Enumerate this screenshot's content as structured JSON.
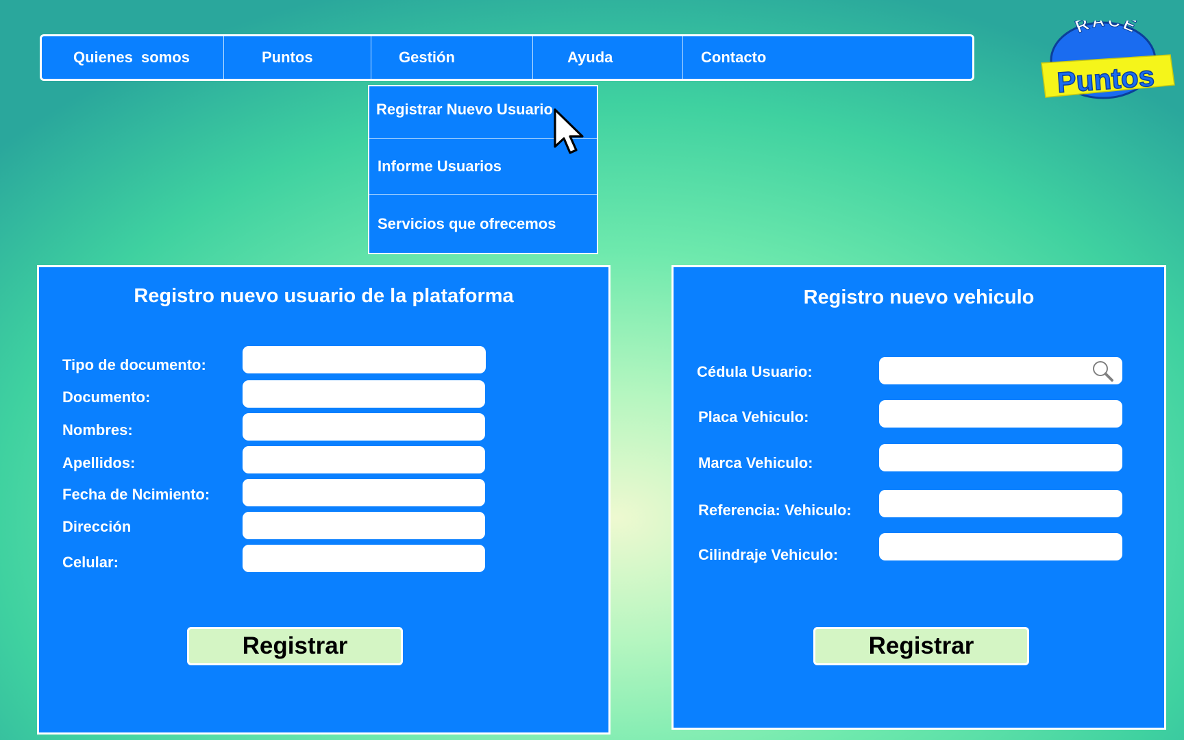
{
  "nav": {
    "items": [
      {
        "label": "Quienes  somos"
      },
      {
        "label": "Puntos"
      },
      {
        "label": "Gestión"
      },
      {
        "label": "Ayuda"
      },
      {
        "label": "Contacto"
      }
    ]
  },
  "dropdown": {
    "items": [
      {
        "label": "Registrar Nuevo Usuario"
      },
      {
        "label": "Informe Usuarios"
      },
      {
        "label": "Servicios que ofrecemos"
      }
    ]
  },
  "logo": {
    "top_text": "RACE",
    "bottom_text": "Puntos"
  },
  "user_form": {
    "title": "Registro nuevo usuario de la plataforma",
    "fields": [
      {
        "label": "Tipo de documento:",
        "value": ""
      },
      {
        "label": "Documento:",
        "value": ""
      },
      {
        "label": "Nombres:",
        "value": ""
      },
      {
        "label": "Apellidos:",
        "value": ""
      },
      {
        "label": "Fecha de Ncimiento:",
        "value": ""
      },
      {
        "label": "Dirección",
        "value": ""
      },
      {
        "label": "Celular:",
        "value": ""
      }
    ],
    "submit_label": "Registrar"
  },
  "vehicle_form": {
    "title": "Registro nuevo vehiculo",
    "fields": [
      {
        "label": "Cédula Usuario:",
        "value": "",
        "icon": "search-icon"
      },
      {
        "label": "Placa Vehiculo:",
        "value": ""
      },
      {
        "label": "Marca Vehiculo:",
        "value": ""
      },
      {
        "label": "Referencia: Vehiculo:",
        "value": ""
      },
      {
        "label": "Cilindraje Vehiculo:",
        "value": ""
      }
    ],
    "submit_label": "Registrar"
  },
  "colors": {
    "primary_blue": "#0a80ff",
    "button_green": "#d4f5c4",
    "logo_yellow": "#f5f51a",
    "logo_blue": "#1a6cf0"
  }
}
